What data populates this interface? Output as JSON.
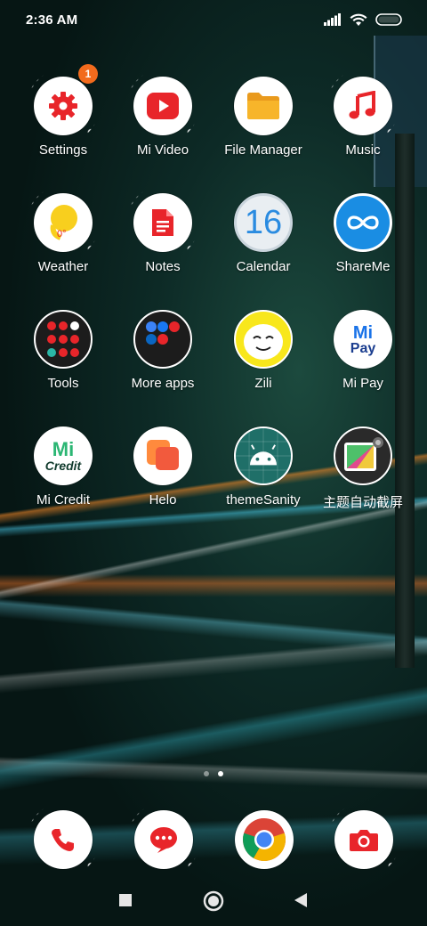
{
  "status_bar": {
    "time": "2:36 AM"
  },
  "apps": [
    {
      "label": "Settings",
      "icon": "settings-gear-icon",
      "badge": "1"
    },
    {
      "label": "Mi Video",
      "icon": "play-icon"
    },
    {
      "label": "File Manager",
      "icon": "folder-icon"
    },
    {
      "label": "Music",
      "icon": "music-note-icon"
    },
    {
      "label": "Weather",
      "icon": "weather-sun-icon",
      "temp": "0°"
    },
    {
      "label": "Notes",
      "icon": "notes-icon"
    },
    {
      "label": "Calendar",
      "icon": "calendar-icon",
      "day": "16"
    },
    {
      "label": "ShareMe",
      "icon": "shareme-icon"
    },
    {
      "label": "Tools",
      "icon": "tools-folder-icon"
    },
    {
      "label": "More apps",
      "icon": "more-apps-folder-icon"
    },
    {
      "label": "Zili",
      "icon": "zili-face-icon"
    },
    {
      "label": "Mi Pay",
      "icon": "mi-pay-icon",
      "icon_text_top": "Mi",
      "icon_text_bottom": "Pay"
    },
    {
      "label": "Mi Credit",
      "icon": "mi-credit-icon",
      "icon_text_top": "Mi",
      "icon_text_bottom": "Credit"
    },
    {
      "label": "Helo",
      "icon": "helo-icon"
    },
    {
      "label": "themeSanity",
      "icon": "android-icon"
    },
    {
      "label": "主题自动截屏",
      "icon": "screenshot-theme-icon"
    }
  ],
  "dock": [
    {
      "name": "phone",
      "icon": "phone-icon"
    },
    {
      "name": "messages",
      "icon": "message-icon"
    },
    {
      "name": "chrome",
      "icon": "chrome-icon"
    },
    {
      "name": "camera",
      "icon": "camera-icon"
    }
  ],
  "page_indicator": {
    "pages": 2,
    "current": 2
  },
  "colors": {
    "badge": "#f26b1d",
    "miui_red": "#e8252a",
    "folder_yellow": "#f7b52a",
    "shareme_blue": "#1a8de3",
    "android_teal": "#1f6f68",
    "mi_green": "#2bb673"
  }
}
